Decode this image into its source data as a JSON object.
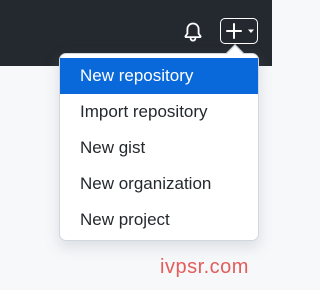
{
  "header": {
    "notification_icon": "bell-icon",
    "create_icon": "plus-icon",
    "dropdown_indicator_icon": "caret-down-icon"
  },
  "create_menu": {
    "items": [
      {
        "label": "New repository",
        "highlighted": true
      },
      {
        "label": "Import repository",
        "highlighted": false
      },
      {
        "label": "New gist",
        "highlighted": false
      },
      {
        "label": "New organization",
        "highlighted": false
      },
      {
        "label": "New project",
        "highlighted": false
      }
    ]
  },
  "watermark": {
    "text": "ivpsr.com"
  },
  "colors": {
    "header_bg": "#24292f",
    "page_bg": "#f6f8fa",
    "highlight_bg": "#0969da",
    "text": "#24292f",
    "watermark": "#e35d5b"
  }
}
